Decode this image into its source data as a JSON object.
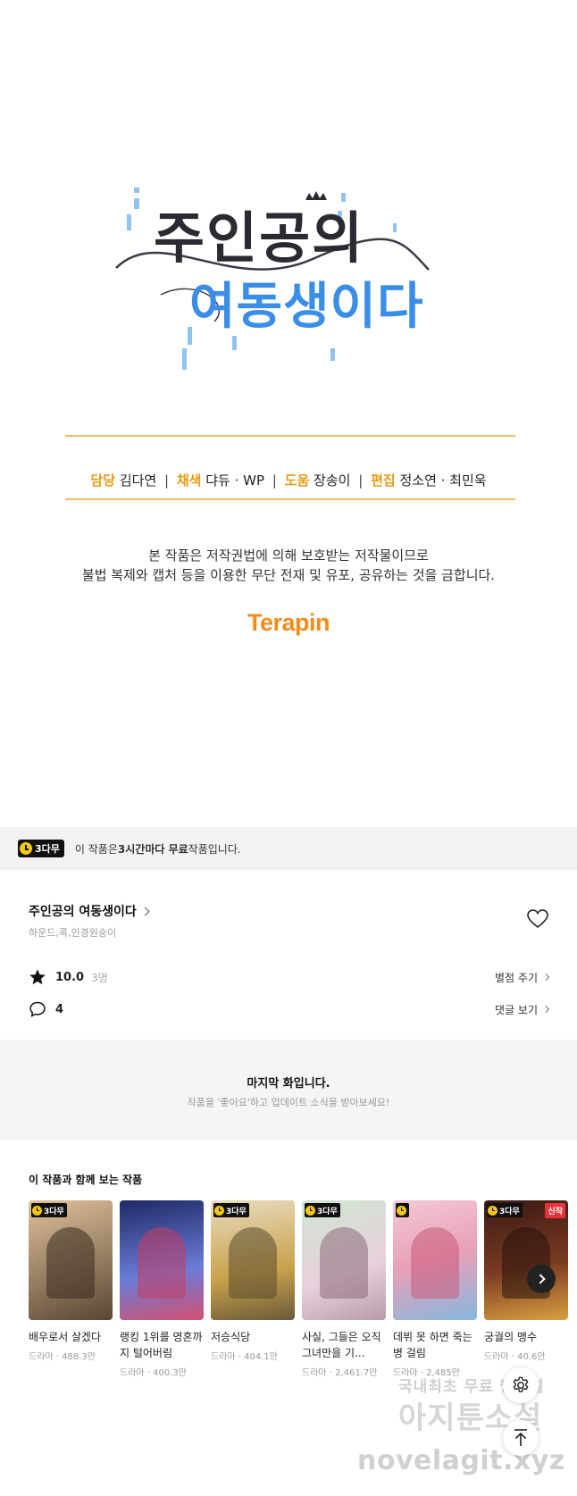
{
  "comic": {
    "logo_line1": "주인공의",
    "logo_line2": "여동생이다",
    "credits": [
      {
        "role": "담당",
        "names": "김다연"
      },
      {
        "role": "채색",
        "names": "댜듀 · WP"
      },
      {
        "role": "도움",
        "names": "장송이"
      },
      {
        "role": "편집",
        "names": "정소연 · 최민욱"
      }
    ],
    "notice_line1": "본 작품은 저작권법에 의해 보호받는 저작물이므로",
    "notice_line2": "불법 복제와 캡처 등을 이용한 무단 전재 및 유포, 공유하는 것을 금합니다.",
    "publisher": "Terapin"
  },
  "free_banner": {
    "badge": "3다무",
    "text_before": "이 작품은 ",
    "text_bold": "3시간마다 무료",
    "text_after": " 작품입니다."
  },
  "info": {
    "title": "주인공의 여동생이다",
    "authors": "하운드,콕,인경원숭이",
    "rating": "10.0",
    "rating_count": "3명",
    "rate_action": "별점 주기",
    "comment_count": "4",
    "comment_action": "댓글 보기"
  },
  "last_episode": {
    "title": "마지막 화입니다.",
    "subtitle": "작품을 '좋아요'하고 업데이트 소식을 받아보세요!"
  },
  "recommend": {
    "heading": "이 작품과 함께 보는 작품",
    "items": [
      {
        "title": "배우로서 살겠다",
        "meta": "드라마 · 488.3만",
        "tag": "3다무",
        "new": "",
        "c1": "#c9a27a",
        "c2": "#4a3b2e"
      },
      {
        "title": "랭킹 1위를 영혼까지 털어버림",
        "meta": "드라마 · 400.3만",
        "tag": "",
        "new": "",
        "c1": "#2e3f8f",
        "c2": "#d04a6a"
      },
      {
        "title": "저승식당",
        "meta": "드라마 · 404.1만",
        "tag": "3다무",
        "new": "",
        "c1": "#d8b86a",
        "c2": "#6b5a3a"
      },
      {
        "title": "사실, 그들은 오직 그녀만을 기...",
        "meta": "드라마 · 2,461.7만",
        "tag": "3다무",
        "new": "",
        "c1": "#9fc3a8",
        "c2": "#c9a4b8"
      },
      {
        "title": "데뷔 못 하면 죽는 병 걸림",
        "meta": "드라마 · 2,485만",
        "tag": "",
        "new": "",
        "c1": "#e8a8b8",
        "c2": "#7fb4d8"
      },
      {
        "title": "궁궐의 맹수",
        "meta": "드라마 · 40.6만",
        "tag": "3다무",
        "new": "신작",
        "c1": "#5a2a20",
        "c2": "#d8a040"
      }
    ]
  },
  "watermark": {
    "line1": "국내최초 무료 웹소설",
    "line2": "아지툰소설",
    "line3": "novelagit.xyz"
  },
  "colors": {
    "accent_orange": "#e89a12",
    "rule": "#f0bd66",
    "publisher": "#f08c18",
    "logo_dark": "#2a2a33",
    "logo_blue": "#3a8ee8"
  }
}
